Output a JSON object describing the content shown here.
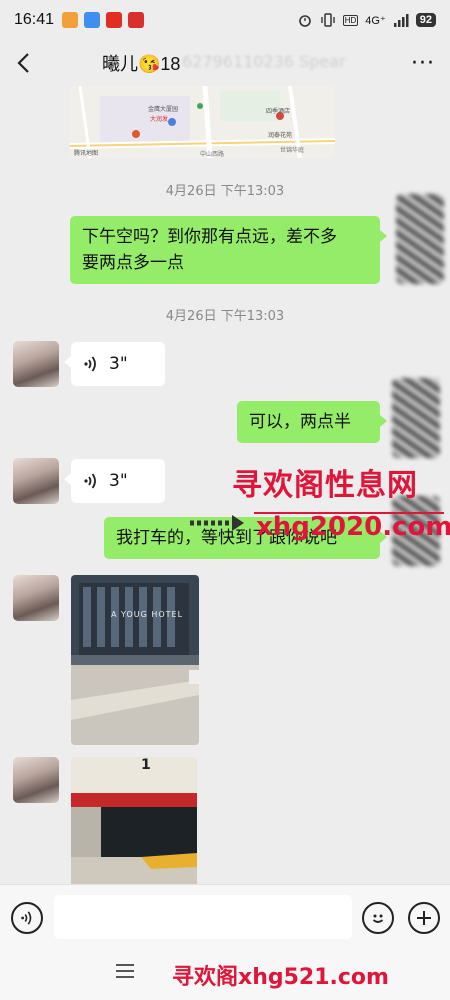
{
  "status_bar": {
    "time": "16:41",
    "network": "4G⁺",
    "hd": "HD",
    "battery": "92"
  },
  "header": {
    "title": "曦儿😘18",
    "title_blurred": "62796110236 Spear",
    "more": "···"
  },
  "map_card": {
    "labels": [
      "金鹰大厦园",
      "大润发",
      "四季酒店",
      "润泰花苑",
      "腾讯地图",
      "中山西路",
      "世锦华庭"
    ]
  },
  "messages": [
    {
      "type": "timestamp",
      "text": "4月26日 下午13:03"
    },
    {
      "type": "text",
      "side": "me",
      "lines": [
        "下午空吗？到你那有点远，差不多",
        "要两点多一点"
      ]
    },
    {
      "type": "timestamp",
      "text": "4月26日 下午13:03"
    },
    {
      "type": "voice",
      "side": "other",
      "duration": "3\""
    },
    {
      "type": "text",
      "side": "me",
      "lines": [
        "可以，两点半"
      ]
    },
    {
      "type": "voice",
      "side": "other",
      "duration": "3\""
    },
    {
      "type": "text",
      "side": "me",
      "lines": [
        "我打车的，等快到了跟你说吧"
      ]
    },
    {
      "type": "image",
      "side": "other",
      "alt": "building-street-photo",
      "sign_text": "A YOUG HOTEL"
    },
    {
      "type": "image",
      "side": "other",
      "alt": "store-entrance-photo",
      "sign_text": "1"
    }
  ],
  "watermarks": {
    "top_cn": "寻欢阁性息网",
    "top_url": "xhg2020.com",
    "bottom": "寻欢阁xhg521.com"
  },
  "input_bar": {
    "placeholder": "",
    "value": ""
  },
  "colors": {
    "my_bubble": "#95ec69",
    "other_bubble": "#ffffff",
    "background": "#ededed",
    "watermark_red": "#e0153a"
  }
}
